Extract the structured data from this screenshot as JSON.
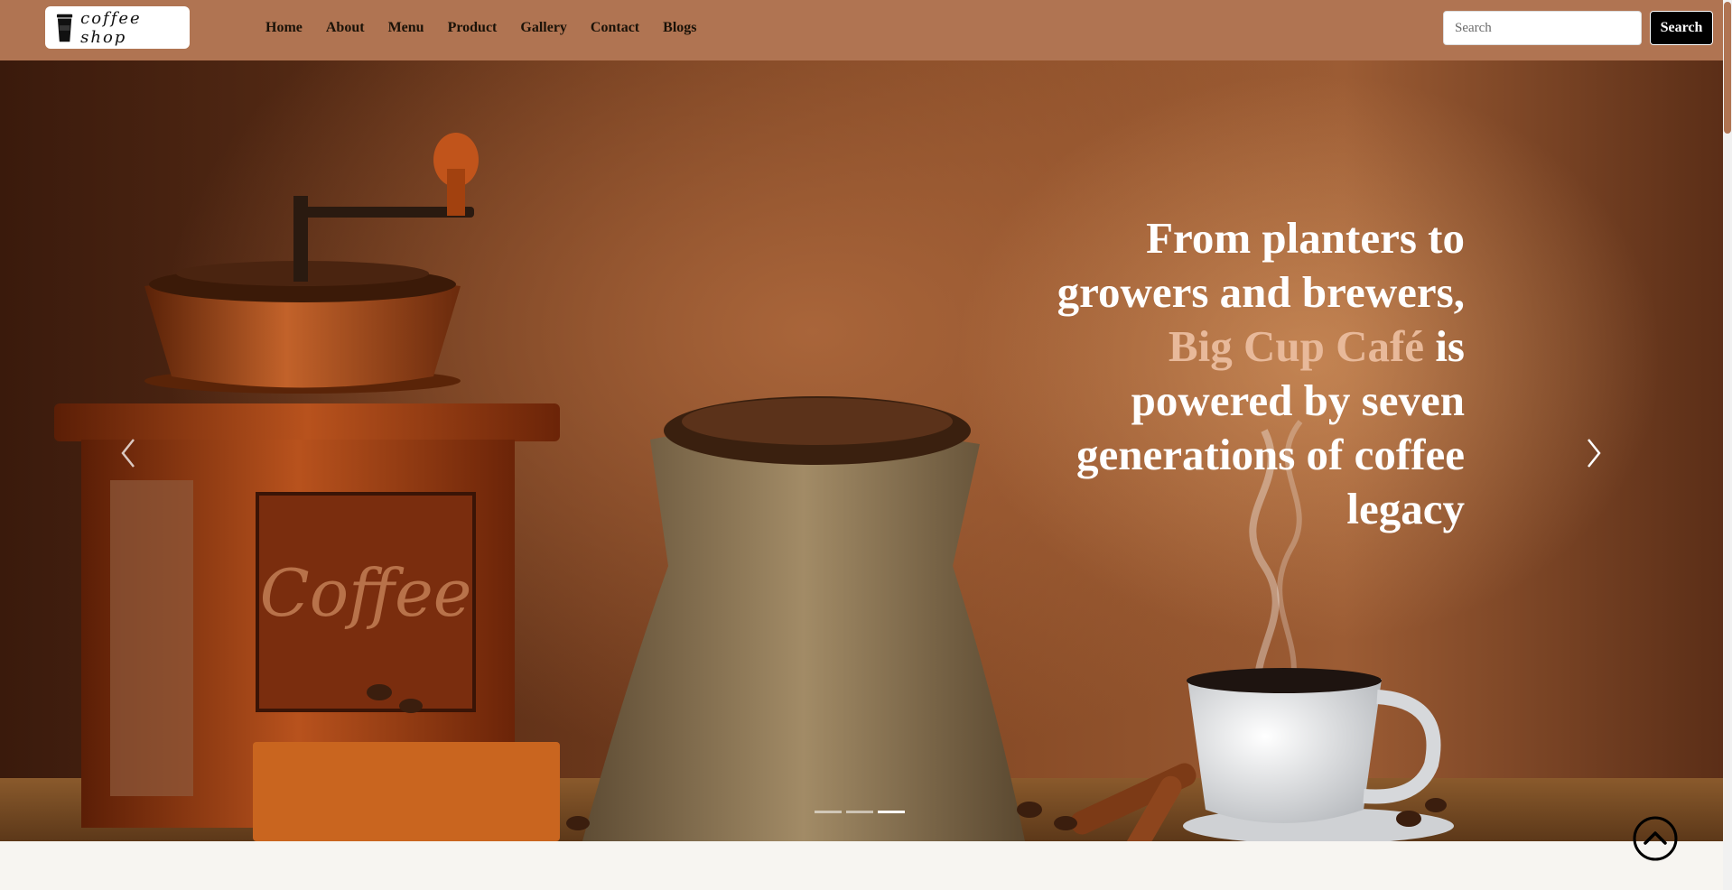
{
  "navbar": {
    "logo_text": "coffee shop",
    "links": [
      "Home",
      "About",
      "Menu",
      "Product",
      "Gallery",
      "Contact",
      "Blogs"
    ],
    "search_placeholder": "Search",
    "search_button": "Search"
  },
  "hero": {
    "line1": "From planters to",
    "line2": "growers and brewers,",
    "line3_accent": "Big Cup Café",
    "line3_rest": " is",
    "line4": "powered by seven",
    "line5": "generations of coffee",
    "line6": "legacy",
    "active_slide": 3,
    "slide_count": 3
  },
  "colors": {
    "navbar": "#b07452",
    "accent_text": "#e8b99a",
    "page_background": "#f7f5f1"
  }
}
